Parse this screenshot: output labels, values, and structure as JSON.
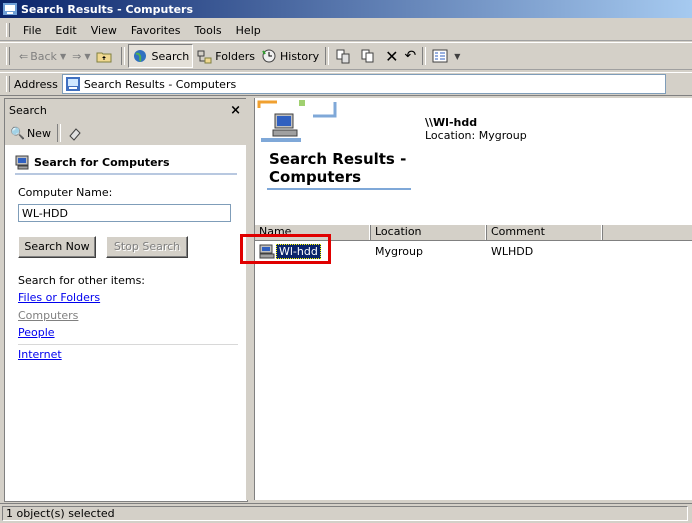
{
  "window": {
    "title": "Search Results - Computers"
  },
  "menu": [
    "File",
    "Edit",
    "View",
    "Favorites",
    "Tools",
    "Help"
  ],
  "toolbar": {
    "back": "Back",
    "search": "Search",
    "folders": "Folders",
    "history": "History"
  },
  "address": {
    "label": "Address",
    "value": "Search Results - Computers"
  },
  "search_pane": {
    "title": "Search",
    "close": "×",
    "new": "New",
    "heading": "Search for Computers",
    "computer_name_label": "Computer Name:",
    "computer_name_value": "WL-HDD",
    "search_now": "Search Now",
    "stop_search": "Stop Search",
    "other_items_label": "Search for other items:",
    "links": {
      "files": "Files or Folders",
      "computers": "Computers",
      "people": "People",
      "internet": "Internet"
    }
  },
  "results": {
    "title_line1": "Search Results -",
    "title_line2": "Computers",
    "selected_name": "\\\\Wl-hdd",
    "selected_location": "Location: Mygroup",
    "columns": [
      "Name",
      "Location",
      "Comment"
    ],
    "rows": [
      {
        "name": "Wl-hdd",
        "location": "Mygroup",
        "comment": "WLHDD"
      }
    ]
  },
  "status": {
    "text": "1 object(s) selected"
  },
  "colors": {
    "title_bar": "#0a246a",
    "highlight_box": "#e00000",
    "selection": "#0a246a"
  }
}
